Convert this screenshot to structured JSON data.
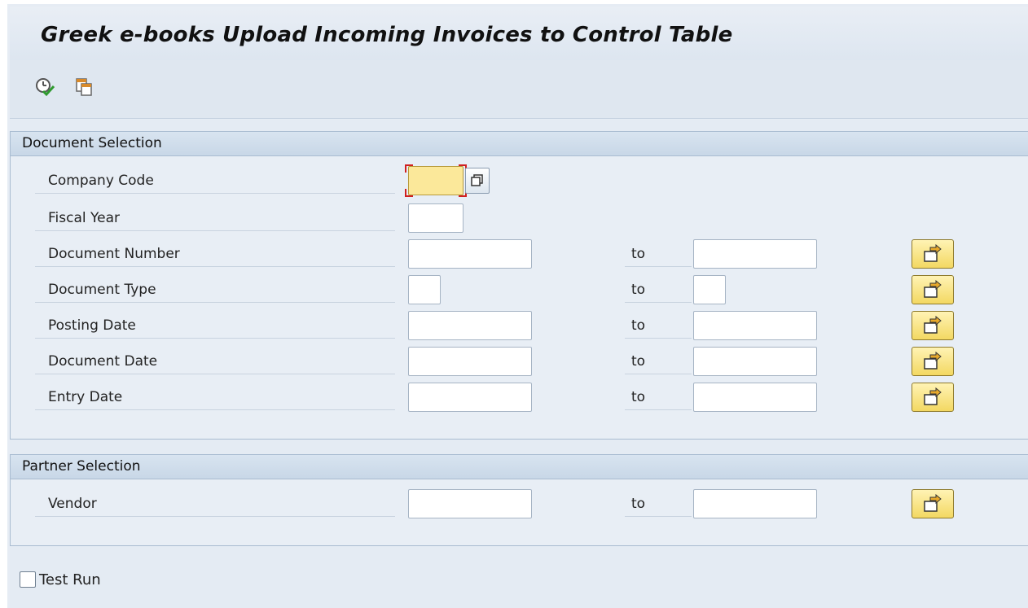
{
  "title": "Greek e-books Upload Incoming Invoices to Control Table",
  "toolbar": {
    "execute_icon": "execute-clock-check-icon",
    "get_variant_icon": "get-variant-icon"
  },
  "document_selection": {
    "header": "Document Selection",
    "company_code": {
      "label": "Company Code",
      "value": ""
    },
    "fiscal_year": {
      "label": "Fiscal Year",
      "value": ""
    },
    "document_number": {
      "label": "Document Number",
      "from": "",
      "to_label": "to",
      "to": ""
    },
    "document_type": {
      "label": "Document Type",
      "from": "",
      "to_label": "to",
      "to": ""
    },
    "posting_date": {
      "label": "Posting Date",
      "from": "",
      "to_label": "to",
      "to": ""
    },
    "document_date": {
      "label": "Document Date",
      "from": "",
      "to_label": "to",
      "to": ""
    },
    "entry_date": {
      "label": "Entry Date",
      "from": "",
      "to_label": "to",
      "to": ""
    }
  },
  "partner_selection": {
    "header": "Partner Selection",
    "vendor": {
      "label": "Vendor",
      "from": "",
      "to_label": "to",
      "to": ""
    }
  },
  "options": {
    "test_run": {
      "label": "Test Run",
      "checked": false
    }
  },
  "colors": {
    "required_field": "#fbe89a",
    "multiple_selection_button": "#f3d862",
    "group_header": "#c8d7e7",
    "background": "#e4ebf3"
  }
}
